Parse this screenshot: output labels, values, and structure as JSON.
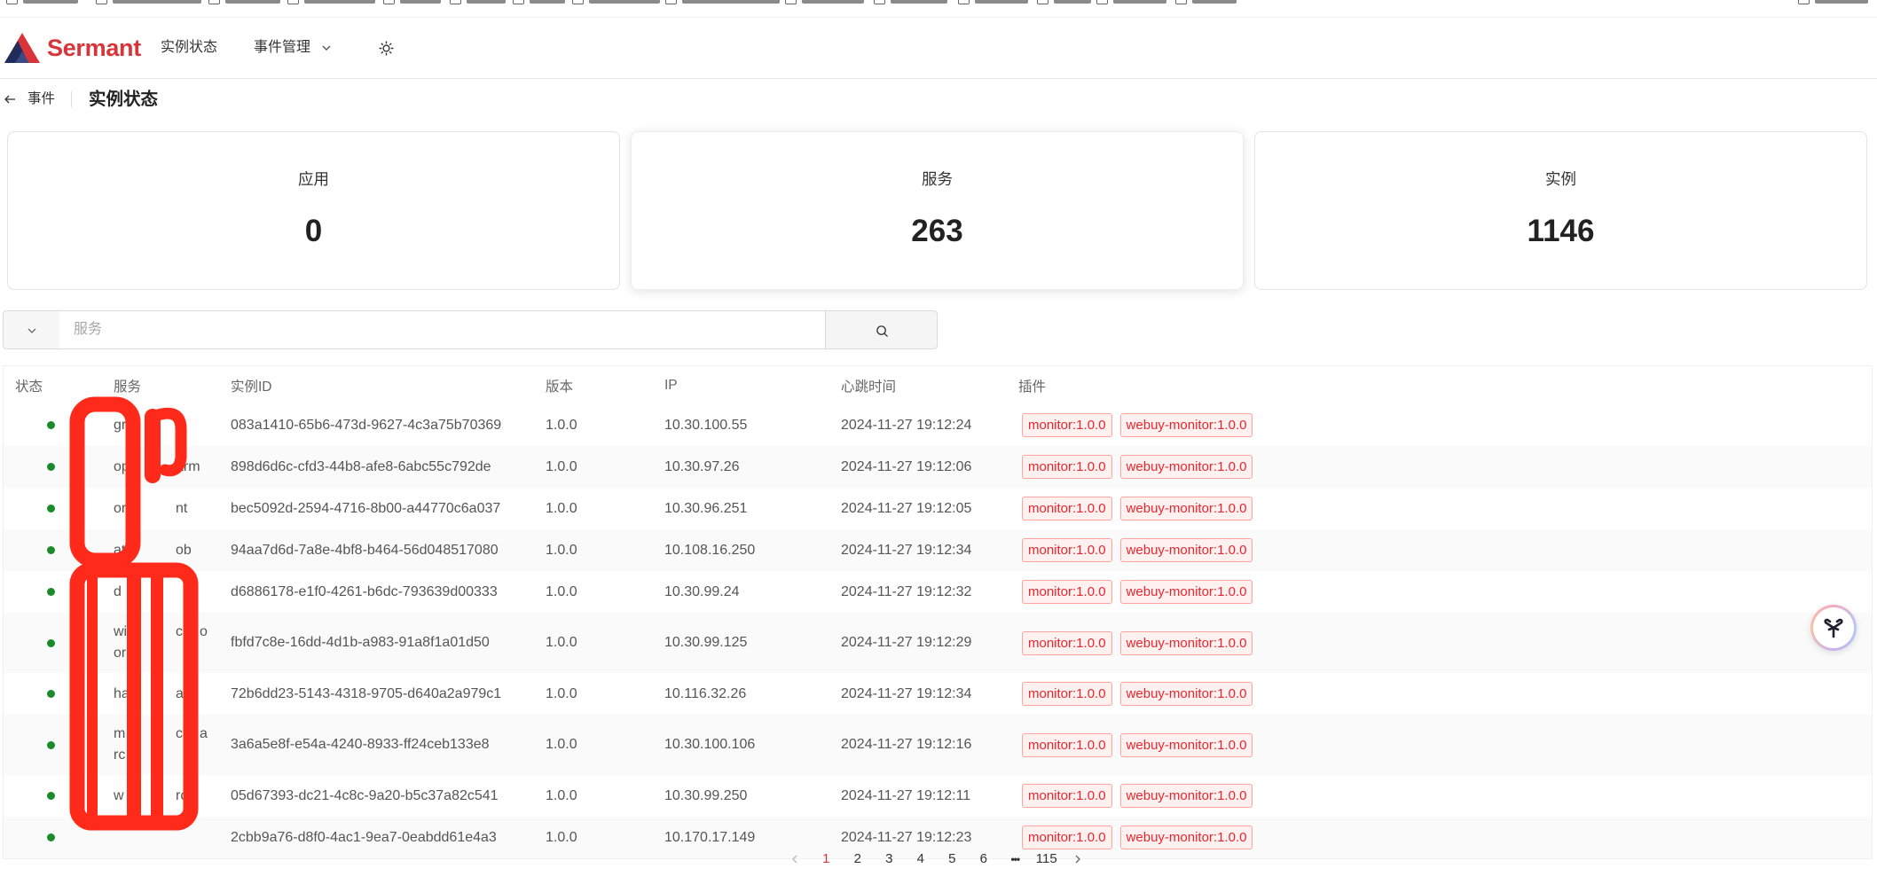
{
  "browser": {
    "bookmark_icon": "folder-icon"
  },
  "header": {
    "logo_text": "Sermant",
    "nav": [
      {
        "label": "实例状态"
      },
      {
        "label": "事件管理",
        "icon": "chevron-down-icon"
      }
    ],
    "theme_icon": "sun-icon"
  },
  "breadcrumb": {
    "back_icon": "arrow-left-icon",
    "back_label": "事件",
    "title": "实例状态"
  },
  "stats": [
    {
      "label": "应用",
      "value": "0"
    },
    {
      "label": "服务",
      "value": "263"
    },
    {
      "label": "实例",
      "value": "1146"
    }
  ],
  "search": {
    "placeholder": "服务",
    "value": "",
    "select_icon": "chevron-down-icon",
    "button_icon": "search-icon"
  },
  "table": {
    "columns": [
      "状态",
      "服务",
      "实例ID",
      "版本",
      "IP",
      "心跳时间",
      "插件"
    ],
    "rows": [
      {
        "service": [
          [
            "gr"
          ]
        ],
        "instance_id": "083a1410-65b6-473d-9627-4c3a75b70369",
        "version": "1.0.0",
        "ip": "10.30.100.55",
        "heartbeat": "2024-11-27 19:12:24",
        "plugins": [
          "monitor:1.0.0",
          "webuy-monitor:1.0.0"
        ]
      },
      {
        "service": [
          [
            "op",
            "arm"
          ]
        ],
        "instance_id": "898d6d6c-cfd3-44b8-afe8-6abc55c792de",
        "version": "1.0.0",
        "ip": "10.30.97.26",
        "heartbeat": "2024-11-27 19:12:06",
        "plugins": [
          "monitor:1.0.0",
          "webuy-monitor:1.0.0"
        ]
      },
      {
        "service": [
          [
            "or",
            "nt"
          ]
        ],
        "instance_id": "bec5092d-2594-4716-8b00-a44770c6a037",
        "version": "1.0.0",
        "ip": "10.30.96.251",
        "heartbeat": "2024-11-27 19:12:05",
        "plugins": [
          "monitor:1.0.0",
          "webuy-monitor:1.0.0"
        ]
      },
      {
        "service": [
          [
            "at",
            "ob"
          ]
        ],
        "instance_id": "94aa7d6d-7a8e-4bf8-b464-56d048517080",
        "version": "1.0.0",
        "ip": "10.108.16.250",
        "heartbeat": "2024-11-27 19:12:34",
        "plugins": [
          "monitor:1.0.0",
          "webuy-monitor:1.0.0"
        ]
      },
      {
        "service": [
          [
            "d"
          ]
        ],
        "instance_id": "d6886178-e1f0-4261-b6dc-793639d00333",
        "version": "1.0.0",
        "ip": "10.30.99.24",
        "heartbeat": "2024-11-27 19:12:32",
        "plugins": [
          "monitor:1.0.0",
          "webuy-monitor:1.0.0"
        ]
      },
      {
        "service": [
          [
            "wi",
            "ch",
            "o"
          ],
          [
            "or"
          ]
        ],
        "instance_id": "fbfd7c8e-16dd-4d1b-a983-91a8f1a01d50",
        "version": "1.0.0",
        "ip": "10.30.99.125",
        "heartbeat": "2024-11-27 19:12:29",
        "plugins": [
          "monitor:1.0.0",
          "webuy-monitor:1.0.0"
        ]
      },
      {
        "service": [
          [
            "ha",
            "ar"
          ]
        ],
        "instance_id": "72b6dd23-5143-4318-9705-d640a2a979c1",
        "version": "1.0.0",
        "ip": "10.116.32.26",
        "heartbeat": "2024-11-27 19:12:34",
        "plugins": [
          "monitor:1.0.0",
          "webuy-monitor:1.0.0"
        ]
      },
      {
        "service": [
          [
            "m",
            "ct",
            "a"
          ],
          [
            "rc"
          ]
        ],
        "instance_id": "3a6a5e8f-e54a-4240-8933-ff24ceb133e8",
        "version": "1.0.0",
        "ip": "10.30.100.106",
        "heartbeat": "2024-11-27 19:12:16",
        "plugins": [
          "monitor:1.0.0",
          "webuy-monitor:1.0.0"
        ]
      },
      {
        "service": [
          [
            "w",
            "rch"
          ]
        ],
        "instance_id": "05d67393-dc21-4c8c-9a20-b5c37a82c541",
        "version": "1.0.0",
        "ip": "10.30.99.250",
        "heartbeat": "2024-11-27 19:12:11",
        "plugins": [
          "monitor:1.0.0",
          "webuy-monitor:1.0.0"
        ]
      },
      {
        "service": [],
        "instance_id": "2cbb9a76-d8f0-4ac1-9ea7-0eabdd61e4a3",
        "version": "1.0.0",
        "ip": "10.170.17.149",
        "heartbeat": "2024-11-27 19:12:23",
        "plugins": [
          "monitor:1.0.0",
          "webuy-monitor:1.0.0"
        ]
      }
    ]
  },
  "pagination": {
    "prev_icon": "chevron-left-icon",
    "pages": [
      "1",
      "2",
      "3",
      "4",
      "5",
      "6"
    ],
    "ellipsis": "•••",
    "last": "115",
    "next_icon": "chevron-right-icon"
  },
  "floating_button_icon": "assistant-icon",
  "colors": {
    "brand_red": "#d8353a",
    "status_online": "#1c8a2b",
    "tag_text": "#e8262e",
    "tag_bg": "#fff1f0",
    "tag_border": "#ffa39e",
    "active_page": "#d6363c",
    "redaction": "#ff2a1a"
  }
}
